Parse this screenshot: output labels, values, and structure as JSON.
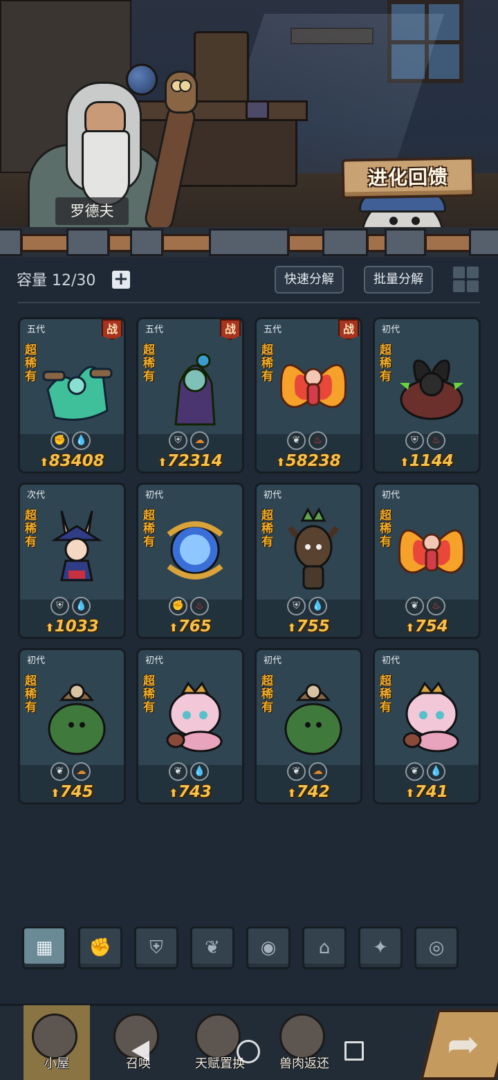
{
  "npc": {
    "name": "罗德夫"
  },
  "evolution_feedback_button": "进化回馈",
  "inventory": {
    "capacity_label": "容量 12/30",
    "add_symbol": "+",
    "quick_decompose": "快速分解",
    "batch_decompose": "批量分解"
  },
  "cards": [
    {
      "generation": "五代",
      "battle": "战",
      "rarity": "超稀有",
      "icons": [
        "fist-icon",
        "water-icon"
      ],
      "power": "83408",
      "creature": "green-tentacle-plant"
    },
    {
      "generation": "五代",
      "battle": "战",
      "rarity": "超稀有",
      "icons": [
        "shield-icon",
        "earth-icon"
      ],
      "power": "72314",
      "creature": "purple-rose-fairy"
    },
    {
      "generation": "五代",
      "battle": "战",
      "rarity": "超稀有",
      "icons": [
        "leaf-icon",
        "fire-icon"
      ],
      "power": "58238",
      "creature": "fire-butterfly-fairy"
    },
    {
      "generation": "初代",
      "battle": "",
      "rarity": "超稀有",
      "icons": [
        "shield-icon",
        "fire-icon"
      ],
      "power": "1144",
      "creature": "horned-beast"
    },
    {
      "generation": "次代",
      "battle": "",
      "rarity": "超稀有",
      "icons": [
        "shield-icon",
        "water-icon"
      ],
      "power": "1033",
      "creature": "bunny-witch"
    },
    {
      "generation": "初代",
      "battle": "",
      "rarity": "超稀有",
      "icons": [
        "fist-icon",
        "fire-icon"
      ],
      "power": "765",
      "creature": "blue-flame-spirit"
    },
    {
      "generation": "初代",
      "battle": "",
      "rarity": "超稀有",
      "icons": [
        "shield-icon",
        "water-icon"
      ],
      "power": "755",
      "creature": "tree-sprite"
    },
    {
      "generation": "初代",
      "battle": "",
      "rarity": "超稀有",
      "icons": [
        "leaf-icon",
        "fire-icon"
      ],
      "power": "754",
      "creature": "fire-butterfly-fairy"
    },
    {
      "generation": "初代",
      "battle": "",
      "rarity": "超稀有",
      "icons": [
        "leaf-icon",
        "earth-icon"
      ],
      "power": "745",
      "creature": "moss-golem"
    },
    {
      "generation": "初代",
      "battle": "",
      "rarity": "超稀有",
      "icons": [
        "leaf-icon",
        "water-icon"
      ],
      "power": "743",
      "creature": "pink-caterpillar"
    },
    {
      "generation": "初代",
      "battle": "",
      "rarity": "超稀有",
      "icons": [
        "leaf-icon",
        "earth-icon"
      ],
      "power": "742",
      "creature": "moss-golem"
    },
    {
      "generation": "初代",
      "battle": "",
      "rarity": "超稀有",
      "icons": [
        "leaf-icon",
        "water-icon"
      ],
      "power": "741",
      "creature": "pink-caterpillar"
    }
  ],
  "filters": [
    {
      "name": "filter-all-icon",
      "symbol": "▦",
      "active": true
    },
    {
      "name": "filter-fist-icon",
      "symbol": "✊",
      "active": false
    },
    {
      "name": "filter-shield-icon",
      "symbol": "⛨",
      "active": false
    },
    {
      "name": "filter-leaf-icon",
      "symbol": "❦",
      "active": false
    },
    {
      "name": "filter-alien-icon",
      "symbol": "◉",
      "active": false
    },
    {
      "name": "filter-tower-icon",
      "symbol": "⌂",
      "active": false
    },
    {
      "name": "filter-star-icon",
      "symbol": "✦",
      "active": false
    },
    {
      "name": "filter-eye-icon",
      "symbol": "◎",
      "active": false
    }
  ],
  "nav": [
    {
      "label": "小屋",
      "active": true
    },
    {
      "label": "召唤",
      "active": false
    },
    {
      "label": "天赋置换",
      "active": false
    },
    {
      "label": "兽肉返还",
      "active": false
    }
  ],
  "colors": {
    "background": "#1e2935",
    "card": "#2f4552",
    "power_gold": "#f6c14c",
    "rarity_orange": "#f1ad2a",
    "battle_red": "#a8341f"
  }
}
